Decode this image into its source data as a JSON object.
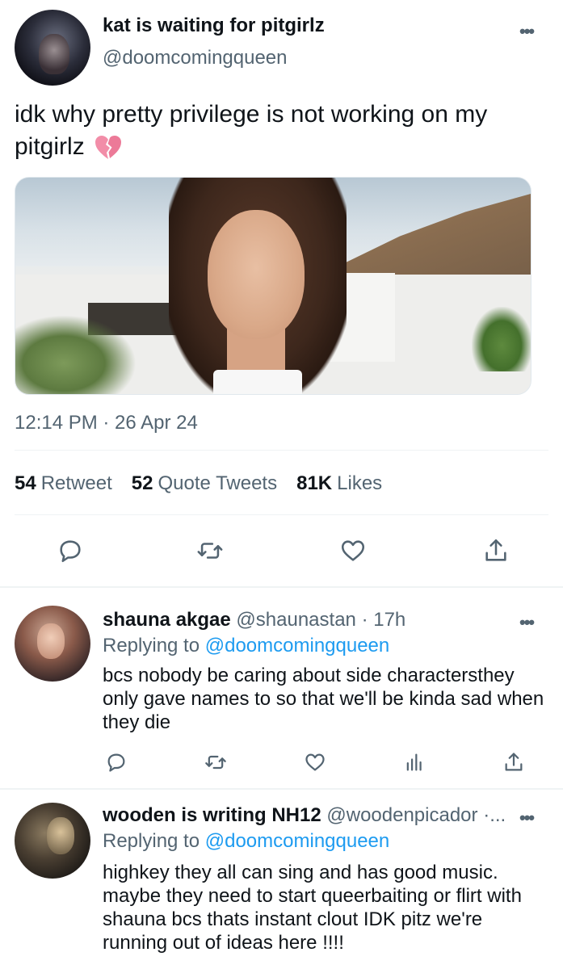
{
  "main_tweet": {
    "author_name": "kat is waiting for pitgirlz",
    "author_handle": "@doomcomingqueen",
    "text": "idk why pretty privilege is not working on my pitgirlz",
    "emoji_icon": "broken-heart-icon",
    "timestamp": "12:14 PM · 26 Apr 24",
    "stats": {
      "retweets_count": "54",
      "retweets_label": "Retweet",
      "quotes_count": "52",
      "quotes_label": "Quote Tweets",
      "likes_count": "81K",
      "likes_label": "Likes"
    },
    "actions": [
      "reply-icon",
      "retweet-icon",
      "like-icon",
      "share-icon"
    ]
  },
  "replies": [
    {
      "author_name": "shauna akgae",
      "author_handle": "@shaunastan",
      "time": "· 17h",
      "replying_label": "Replying to",
      "replying_to": "@doomcomingqueen",
      "text": "bcs nobody be caring about side charactersthey only gave names to so that we'll be kinda sad when they die",
      "actions": [
        "reply-icon",
        "retweet-icon",
        "like-icon",
        "analytics-icon",
        "share-icon"
      ]
    },
    {
      "author_name": "wooden is writing NH12",
      "author_handle": "@woodenpicador",
      "time": "·...",
      "replying_label": "Replying to",
      "replying_to": "@doomcomingqueen",
      "text": "highkey they all can sing and has good music. maybe they need to start queerbaiting or flirt with shauna bcs thats instant clout IDK pitz we're running out of ideas here !!!!"
    }
  ],
  "colors": {
    "text_primary": "#0f1419",
    "text_secondary": "#536471",
    "link": "#1d9bf0",
    "divider": "#eff3f4",
    "broken_heart": "#f28da8"
  }
}
